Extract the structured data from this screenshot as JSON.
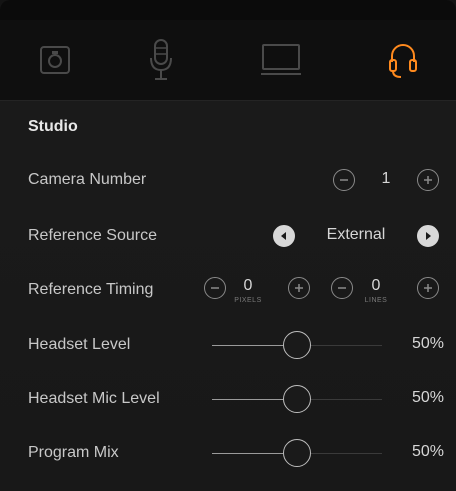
{
  "tabs": [
    {
      "icon": "camera-icon",
      "active": false
    },
    {
      "icon": "microphone-icon",
      "active": false
    },
    {
      "icon": "monitor-icon",
      "active": false
    },
    {
      "icon": "headset-icon",
      "active": true
    }
  ],
  "accent": "#ff8a1e",
  "section": {
    "title": "Studio"
  },
  "rows": {
    "camera_number": {
      "label": "Camera Number",
      "value": "1"
    },
    "reference_source": {
      "label": "Reference Source",
      "value": "External"
    },
    "reference_timing": {
      "label": "Reference Timing",
      "pixels_value": "0",
      "pixels_unit": "PIXELS",
      "lines_value": "0",
      "lines_unit": "LINES"
    },
    "headset_level": {
      "label": "Headset Level",
      "value_text": "50%",
      "level": 0.5
    },
    "headset_mic_level": {
      "label": "Headset Mic Level",
      "value_text": "50%",
      "level": 0.5
    },
    "program_mix": {
      "label": "Program Mix",
      "value_text": "50%",
      "level": 0.5
    }
  }
}
